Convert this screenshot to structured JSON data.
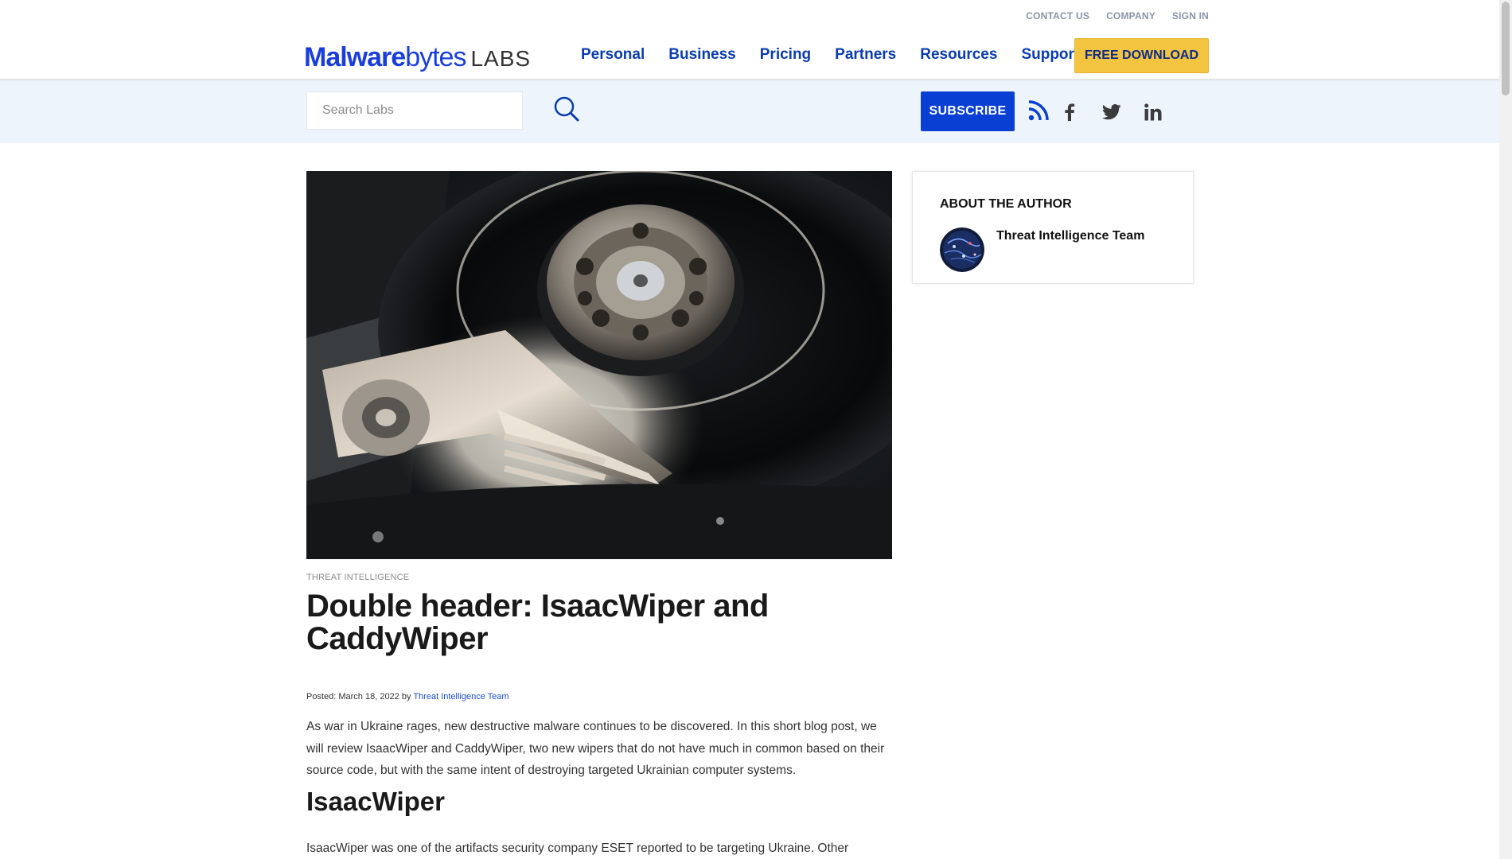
{
  "header": {
    "utility_nav": [
      "CONTACT US",
      "COMPANY",
      "SIGN IN"
    ],
    "logo": {
      "brand_bold": "Malware",
      "brand_light": "bytes",
      "suffix": "LABS"
    },
    "main_nav": [
      "Personal",
      "Business",
      "Pricing",
      "Partners",
      "Resources",
      "Support"
    ],
    "download_button": "FREE DOWNLOAD"
  },
  "subbar": {
    "search_placeholder": "Search Labs",
    "subscribe_button": "SUBSCRIBE",
    "social_icons": [
      "rss-icon",
      "facebook-icon",
      "twitter-icon",
      "linkedin-icon"
    ]
  },
  "article": {
    "category": "THREAT INTELLIGENCE",
    "title": "Double header: IsaacWiper and CaddyWiper",
    "meta_prefix": "Posted: March 18, 2022 by",
    "author_link": "Threat Intelligence Team",
    "intro": "As war in Ukraine rages, new destructive malware continues to be discovered. In this short blog post, we will review IsaacWiper and CaddyWiper, two new wipers that do not have much in common based on their source code, but with the same intent of destroying targeted Ukrainian computer systems.",
    "section_heading": "IsaacWiper",
    "section_text": "IsaacWiper was one of the artifacts security company ESET reported to be targeting Ukraine. Other"
  },
  "sidebar": {
    "heading": "ABOUT THE AUTHOR",
    "author_name": "Threat Intelligence Team"
  },
  "colors": {
    "brand_blue": "#0a3cb0",
    "download_yellow": "#f3c440",
    "subscribe_blue": "#0a3fd4",
    "subbar_bg": "#eef4fb"
  }
}
